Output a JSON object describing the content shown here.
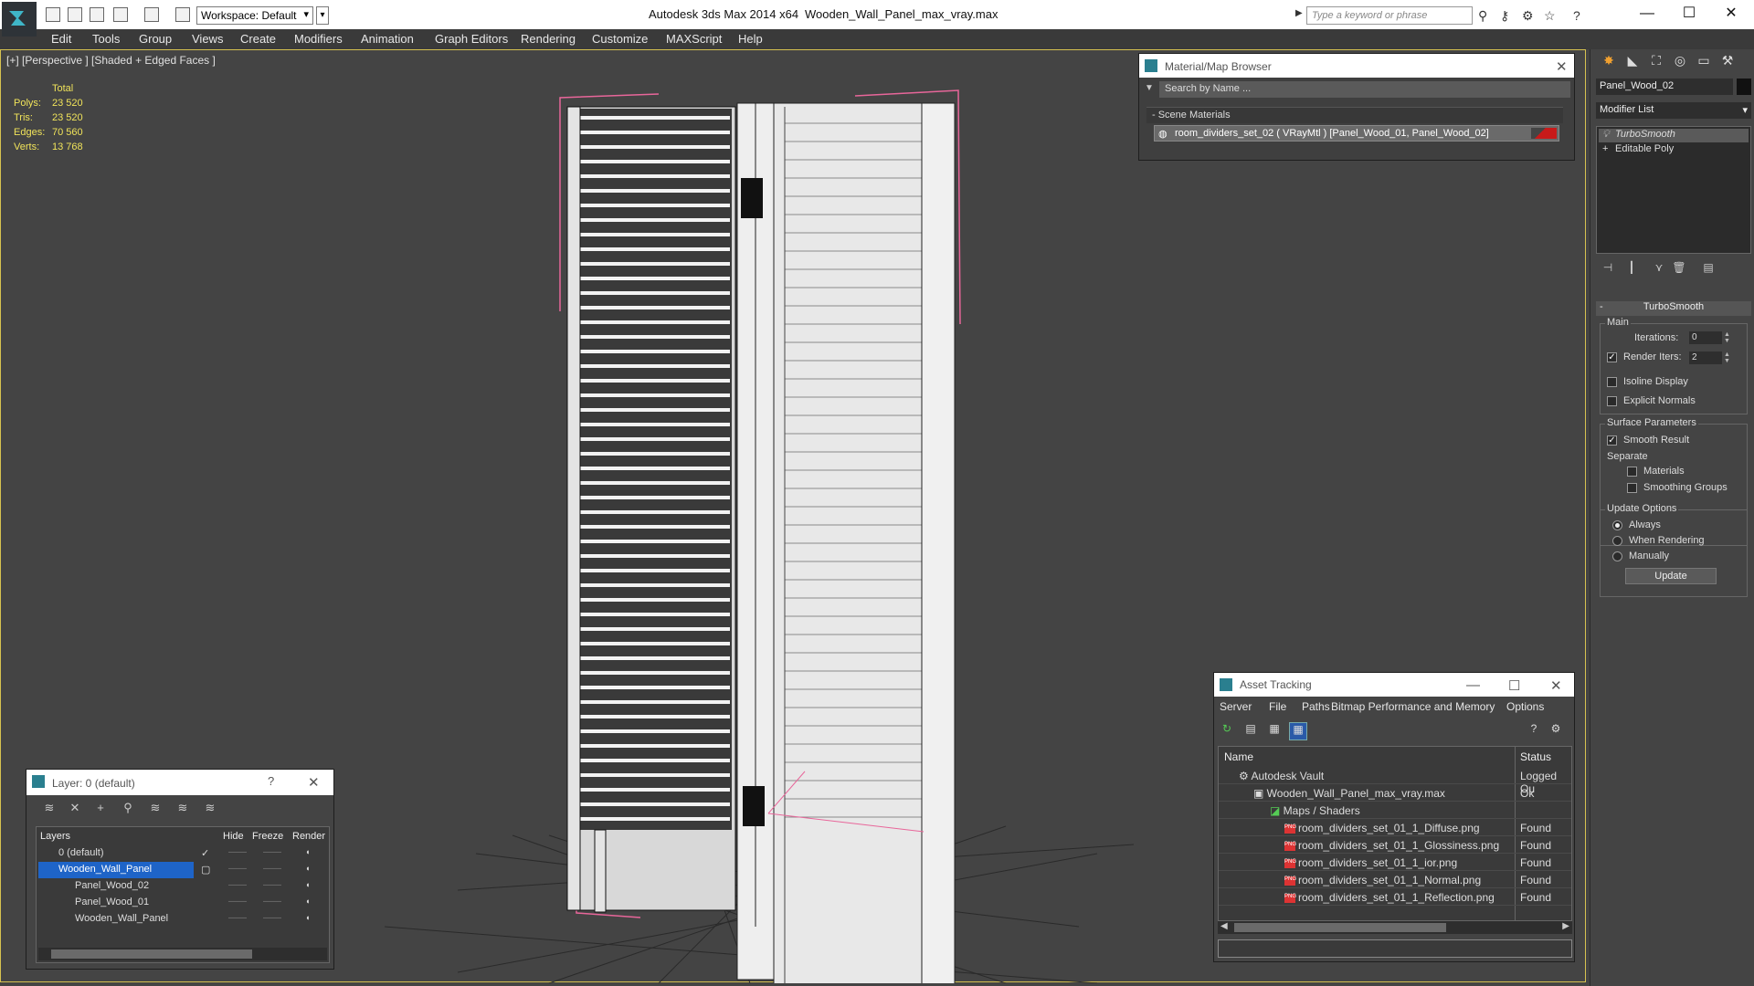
{
  "titlebar": {
    "workspace": "Workspace: Default",
    "app_title": "Autodesk 3ds Max  2014 x64",
    "file_title": "Wooden_Wall_Panel_max_vray.max",
    "search_placeholder": "Type a keyword or phrase",
    "min": "—",
    "max": "☐",
    "close": "✕"
  },
  "menu": [
    "Edit",
    "Tools",
    "Group",
    "Views",
    "Create",
    "Modifiers",
    "Animation",
    "Graph Editors",
    "Rendering",
    "Customize",
    "MAXScript",
    "Help"
  ],
  "viewport": {
    "label": "[+] [Perspective ] [Shaded + Edged Faces ]",
    "stats": {
      "header": "Total",
      "polys_label": "Polys:",
      "polys": "23 520",
      "tris_label": "Tris:",
      "tris": "23 520",
      "edges_label": "Edges:",
      "edges": "70 560",
      "verts_label": "Verts:",
      "verts": "13 768"
    }
  },
  "material_browser": {
    "title": "Material/Map Browser",
    "search": "Search by Name ...",
    "section": "- Scene Materials",
    "item": "room_dividers_set_02  ( VRayMtl )  [Panel_Wood_01, Panel_Wood_02]"
  },
  "command_panel": {
    "object_name": "Panel_Wood_02",
    "modifier_list": "Modifier List",
    "stack": [
      "TurboSmooth",
      "Editable Poly"
    ],
    "rollout": "TurboSmooth",
    "main_label": "Main",
    "iterations_label": "Iterations:",
    "iterations": "0",
    "render_iters_label": "Render Iters:",
    "render_iters": "2",
    "isoline": "Isoline Display",
    "explicit_normals": "Explicit Normals",
    "surface_params": "Surface Parameters",
    "smooth_result": "Smooth Result",
    "separate": "Separate",
    "materials": "Materials",
    "smoothing_groups": "Smoothing Groups",
    "update_options": "Update Options",
    "always": "Always",
    "when_rendering": "When Rendering",
    "manually": "Manually",
    "update_btn": "Update"
  },
  "layer_panel": {
    "title": "Layer: 0 (default)",
    "help": "?",
    "close": "✕",
    "cols": [
      "Layers",
      "Hide",
      "Freeze",
      "Render"
    ],
    "rows": [
      "0 (default)",
      "Wooden_Wall_Panel",
      "Panel_Wood_02",
      "Panel_Wood_01",
      "Wooden_Wall_Panel"
    ],
    "dash": "——",
    "check": "✓"
  },
  "asset_tracking": {
    "title": "Asset Tracking",
    "menu": [
      "Server",
      "File",
      "Paths",
      "Bitmap Performance and Memory",
      "Options"
    ],
    "cols": [
      "Name",
      "Status"
    ],
    "rows": [
      {
        "name": "Autodesk Vault",
        "status": "Logged Ou"
      },
      {
        "name": "Wooden_Wall_Panel_max_vray.max",
        "status": "Ok"
      },
      {
        "name": "Maps / Shaders",
        "status": ""
      },
      {
        "name": "room_dividers_set_01_1_Diffuse.png",
        "status": "Found"
      },
      {
        "name": "room_dividers_set_01_1_Glossiness.png",
        "status": "Found"
      },
      {
        "name": "room_dividers_set_01_1_ior.png",
        "status": "Found"
      },
      {
        "name": "room_dividers_set_01_1_Normal.png",
        "status": "Found"
      },
      {
        "name": "room_dividers_set_01_1_Reflection.png",
        "status": "Found"
      }
    ],
    "png_badge": "PNG"
  },
  "colors": {
    "accent_selection": "#1e64c8",
    "stats_yellow": "#f0e35a",
    "viewport_border": "#d6c250",
    "wire_pink": "#e8669a"
  }
}
